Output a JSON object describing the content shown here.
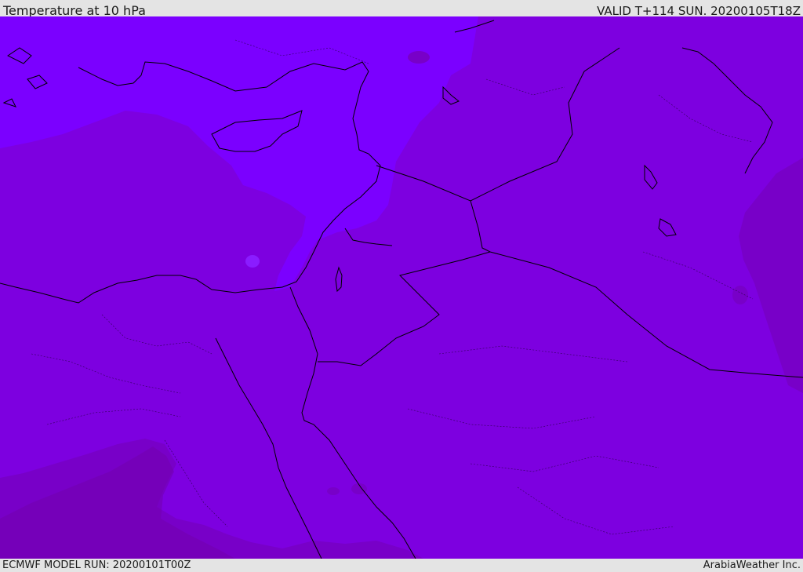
{
  "header": {
    "title": "Temperature at 10 hPa",
    "valid": "VALID T+114 SUN. 20200105T18Z"
  },
  "footer": {
    "model_run": "ECMWF MODEL RUN: 20200101T00Z",
    "credit": "ArabiaWeather Inc."
  },
  "colors": {
    "band_coldest": "#7b00ff",
    "band_cold": "#7d00e0",
    "band_mid": "#7800c8",
    "band_warm": "#7300ad",
    "coast_line": "#000000",
    "frame_bg": "#e4e4e4"
  }
}
